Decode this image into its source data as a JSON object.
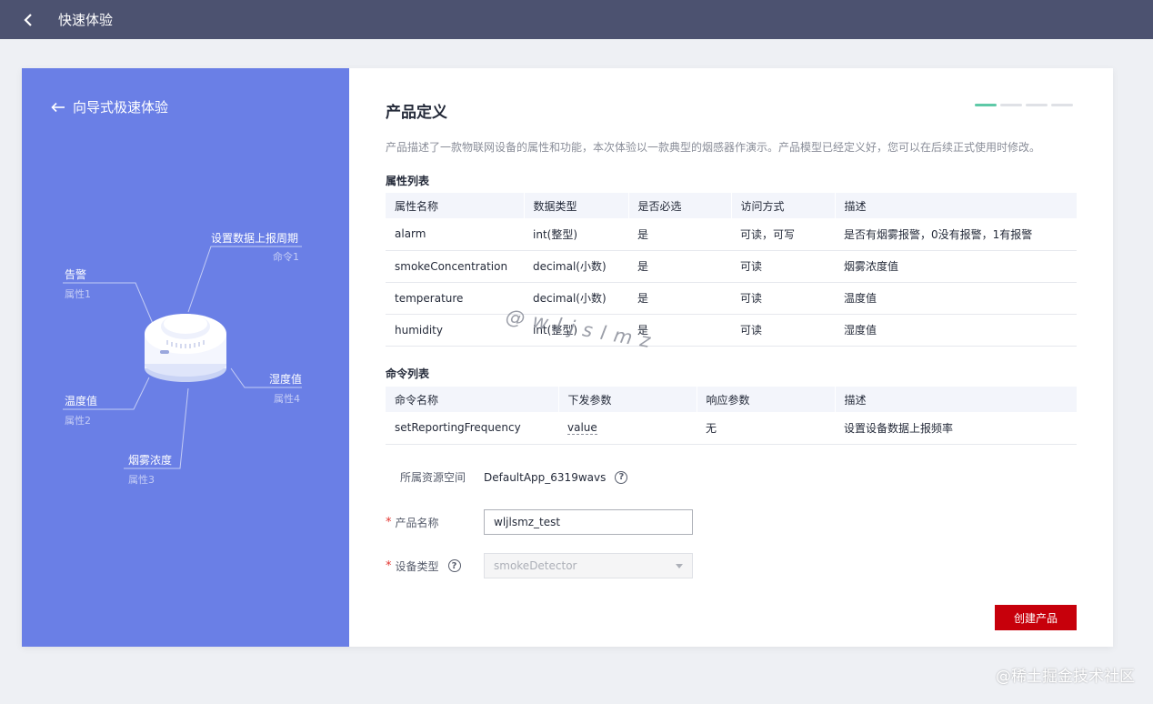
{
  "topbar": {
    "title": "快速体验",
    "back_icon": "chevron-left-icon"
  },
  "left": {
    "title": "向导式极速体验",
    "back_icon": "arrow-left-icon",
    "callouts": [
      {
        "name": "设置数据上报周期",
        "sub": "命令1"
      },
      {
        "name": "告警",
        "sub": "属性1"
      },
      {
        "name": "湿度值",
        "sub": "属性4"
      },
      {
        "name": "温度值",
        "sub": "属性2"
      },
      {
        "name": "烟雾浓度",
        "sub": "属性3"
      }
    ]
  },
  "main": {
    "title": "产品定义",
    "steps": {
      "total": 4,
      "active": 1
    },
    "description": "产品描述了一款物联网设备的属性和功能，本次体验以一款典型的烟感器作演示。产品模型已经定义好，您可以在后续正式使用时修改。",
    "properties": {
      "title": "属性列表",
      "headers": [
        "属性名称",
        "数据类型",
        "是否必选",
        "访问方式",
        "描述"
      ],
      "rows": [
        {
          "name": "alarm",
          "type": "int(整型)",
          "required": "是",
          "access": "可读，可写",
          "desc": "是否有烟雾报警，0没有报警，1有报警"
        },
        {
          "name": "smokeConcentration",
          "type": "decimal(小数)",
          "required": "是",
          "access": "可读",
          "desc": "烟雾浓度值"
        },
        {
          "name": "temperature",
          "type": "decimal(小数)",
          "required": "是",
          "access": "可读",
          "desc": "温度值"
        },
        {
          "name": "humidity",
          "type": "int(整型)",
          "required": "是",
          "access": "可读",
          "desc": "湿度值"
        }
      ]
    },
    "commands": {
      "title": "命令列表",
      "headers": [
        "命令名称",
        "下发参数",
        "响应参数",
        "描述"
      ],
      "rows": [
        {
          "name": "setReportingFrequency",
          "param": "value",
          "response": "无",
          "desc": "设置设备数据上报频率"
        }
      ]
    },
    "form": {
      "space_label": "所属资源空间",
      "space_value": "DefaultApp_6319wavs",
      "product_name_label": "产品名称",
      "product_name_value": "wljlsmz_test",
      "device_type_label": "设备类型",
      "device_type_value": "smokeDetector"
    },
    "create_button": "创建产品"
  },
  "watermark": "@wljslmz",
  "corner_watermark": "@稀土掘金技术社区",
  "colors": {
    "topbar": "#4c5270",
    "left_panel": "#6a7fe6",
    "step_active": "#5ec9a7",
    "primary_button": "#c7000b"
  }
}
